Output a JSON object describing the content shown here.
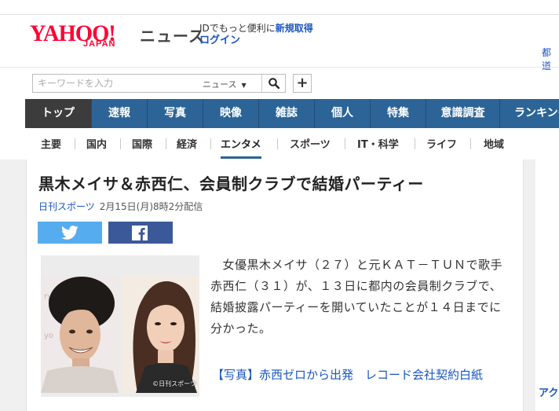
{
  "header": {
    "logo_text": "YAHOO!",
    "logo_sub": "JAPAN",
    "section": "ニュース",
    "promo_prefix": "IDでもっと便利に",
    "promo_link": "新規取得",
    "login": "ログイン",
    "right_partial": "都道"
  },
  "search": {
    "placeholder": "キーワードを入力",
    "scope": "ニュース",
    "plus_label": "+"
  },
  "main_nav": [
    "トップ",
    "速報",
    "写真",
    "映像",
    "雑誌",
    "個人",
    "特集",
    "意識調査",
    "ランキング"
  ],
  "sub_nav": [
    "主要",
    "国内",
    "国際",
    "経済",
    "エンタメ",
    "スポーツ",
    "IT・科学",
    "ライフ",
    "地域"
  ],
  "article": {
    "title": "黒木メイサ＆赤西仁、会員制クラブで結婚パーティー",
    "source": "日刊スポーツ",
    "date": "2月15日(月)8時2分配信",
    "body": "　女優黒木メイサ（２７）と元ＫＡＴ－ＴＵＮで歌手赤西仁（３１）が、１３日に都内の会員制クラブで、結婚披露パーティーを開いていたことが１４日までに分かった。",
    "photo_credit": "©日刊スポーツ",
    "related_link": "【写真】赤西ゼロから出発　レコード会社契約白紙"
  },
  "sidebar": {
    "partial": "アク"
  },
  "colors": {
    "brand_red": "#ff0033",
    "nav_blue": "#2c6497",
    "nav_active": "#3c3c3c",
    "link_blue": "#1a55c0",
    "twitter": "#55acee",
    "facebook": "#3b5998"
  }
}
